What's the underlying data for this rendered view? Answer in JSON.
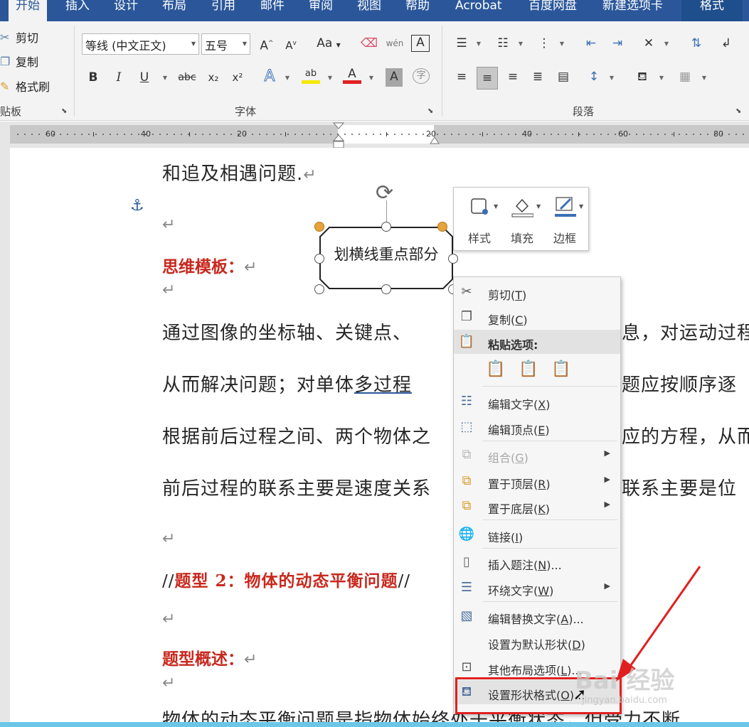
{
  "tabs": {
    "home": "开始",
    "insert": "插入",
    "design": "设计",
    "layout": "布局",
    "references": "引用",
    "mailings": "邮件",
    "review": "审阅",
    "view": "视图",
    "help": "帮助",
    "acrobat": "Acrobat",
    "baidu": "百度网盘",
    "newtab": "新建选项卡",
    "format": "格式"
  },
  "clipboard": {
    "cut": "剪切",
    "copy": "复制",
    "painter": "格式刷",
    "label": "贴板"
  },
  "font": {
    "name": "等线 (中文正文)",
    "size": "五号",
    "label": "字体",
    "grow": "A",
    "shrink": "A",
    "case": "Aa",
    "phonetic": "wén",
    "border_char": "A",
    "bold": "B",
    "italic": "I",
    "underline": "U",
    "strike": "abc",
    "sub": "x₂",
    "sup": "x²",
    "effects": "A",
    "highlight": "ab",
    "color": "A",
    "shading": "A",
    "enclose": "字"
  },
  "paragraph": {
    "label": "段落"
  },
  "ruler": {
    "n60l": "60",
    "n40l": "40",
    "n20l": "20",
    "n20r": "20",
    "n40r": "40",
    "n60r": "60",
    "n80r": "80"
  },
  "doc": {
    "line1": "和追及相遇问题.",
    "pmark": "↵",
    "heading1": "思维模板：",
    "p1": "通过图像的坐标轴、关键点、",
    "p1b": "息，对运动过程",
    "p2a": "从而解决问题；对单体",
    "p2u": "多过程",
    "p2b": "题应按顺序逐",
    "p3a": "根据前后过程之间、两个物体之",
    "p3b": "应的方程，从而",
    "p4a": "前后过程的联系主要是速度关系",
    "p4b": "联系主要是位",
    "comment_open": "//",
    "heading2": "题型 2：物体的动态平衡问题",
    "comment_close": "//",
    "heading3": "题型概述：",
    "p5": "物体的动态平衡问题是指物体始终处于平衡状态，但受力不断"
  },
  "shape": {
    "text": "划横线重点部分"
  },
  "mini_toolbar": {
    "style": "样式",
    "fill": "填充",
    "outline": "边框"
  },
  "context_menu": {
    "cut": "剪切(T)",
    "cut_pre": "剪切(",
    "cut_key": "T",
    "post": ")",
    "copy_pre": "复制(",
    "copy_key": "C",
    "paste_header": "粘贴选项:",
    "edit_text_pre": "编辑文字(",
    "edit_text_key": "X",
    "edit_points_pre": "编辑顶点(",
    "edit_points_key": "E",
    "group_pre": "组合(",
    "group_key": "G",
    "front_pre": "置于顶层(",
    "front_key": "R",
    "back_pre": "置于底层(",
    "back_key": "K",
    "link_pre": "链接(",
    "link_key": "I",
    "caption_pre": "插入题注(",
    "caption_key": "N",
    "caption_post": ")...",
    "wrap_pre": "环绕文字(",
    "wrap_key": "W",
    "alt_pre": "编辑替换文字(",
    "alt_key": "A",
    "alt_post": ")...",
    "default_pre": "设置为默认形状(",
    "default_key": "D",
    "more_layout_pre": "其他布局选项(",
    "more_layout_key": "L",
    "more_layout_post": ")...",
    "format_shape_pre": "设置形状格式(",
    "format_shape_key": "O",
    "format_shape_post": ")..."
  },
  "watermark": {
    "main": "Bai 经验",
    "sub": "jingyan.baidu.com"
  },
  "colors": {
    "ribbon_blue": "#2b579a",
    "heading_red": "#c8281e",
    "callout_red": "#e02020"
  }
}
